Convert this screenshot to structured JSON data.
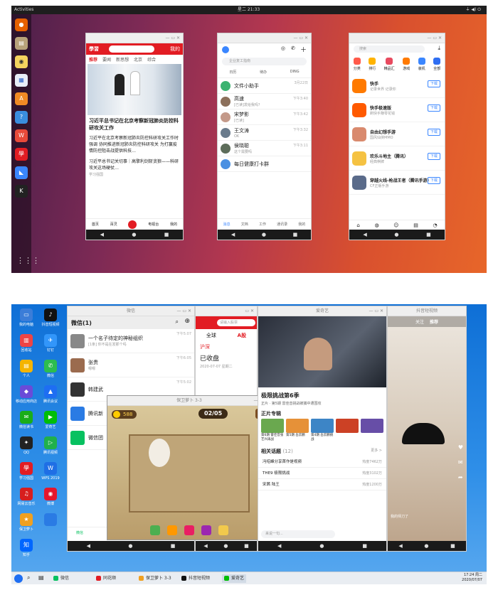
{
  "top": {
    "activities": "Activities",
    "clock": "星二 21:33",
    "news": {
      "tabs": [
        "推荐",
        "要闻",
        "新思想",
        "北京",
        "综合"
      ],
      "right_tab": "我的",
      "headline1": "习近平总书记在北京考察新冠肺炎防控科研攻关工作",
      "headline2": "习近平在北京考察新冠肺炎防控科研攻关工作时强调 协同推进新冠肺炎防控科研攻关 为打赢疫情防控阻击战提供科技…",
      "headline3": "习近平总书记关切事｜高擎利剑斩贪狼——科研攻关这场硬仗…",
      "source": "学习强国",
      "nav": [
        "首页",
        "百灵",
        "",
        "电视台",
        "我的"
      ]
    },
    "wechat": {
      "search_placeholder": "企业复工指南",
      "quick": [
        "日历",
        "待办",
        "DING"
      ],
      "chats": [
        {
          "name": "文件小助手",
          "msg": "",
          "time": "3月22日",
          "color": "#3cb371"
        },
        {
          "name": "高速",
          "msg": "[已读]发给我吗？",
          "time": "下午3:40",
          "color": "#8b6f5a"
        },
        {
          "name": "宋梦影",
          "msg": "[已读]",
          "time": "下午3:42",
          "color": "#c49a8a"
        },
        {
          "name": "王文涛",
          "msg": "OK",
          "time": "下午3:32",
          "color": "#6a7b8c"
        },
        {
          "name": "侯晓聪",
          "msg": "这个需要吗",
          "time": "下午3:11",
          "color": "#5d6d5a"
        },
        {
          "name": "每日健康打卡群",
          "msg": "",
          "time": "",
          "color": "#4a90e2"
        }
      ],
      "nav": [
        "消息",
        "文档",
        "工作",
        "通讯录",
        "我的"
      ]
    },
    "store": {
      "search_placeholder": "搜索",
      "cats": [
        "分类",
        "排行",
        "精品汇",
        "游戏",
        "装机",
        "全部"
      ],
      "apps": [
        {
          "name": "快手",
          "desc": "记录世界 记录你",
          "color": "#ff7a00"
        },
        {
          "name": "快手极速版",
          "desc": "刷快手赚零花钱",
          "color": "#ff5a00"
        },
        {
          "name": "自由幻想手游",
          "desc": "国风仙侠MMO",
          "color": "#d98a6e"
        },
        {
          "name": "欢乐斗地主（腾讯）",
          "desc": "经典棋牌",
          "color": "#f5c242"
        },
        {
          "name": "穿越火线-枪战王者（腾讯手游）",
          "desc": "CF正版手游",
          "color": "#5a6b8a"
        }
      ],
      "download": "下载"
    }
  },
  "bottom": {
    "desktop_icons": [
      {
        "label": "我的电脑",
        "color": "#3b7dd8",
        "glyph": "▭"
      },
      {
        "label": "抖音短视频",
        "color": "#111",
        "glyph": "♪"
      },
      {
        "label": "回收站",
        "color": "#e44",
        "glyph": "▥"
      },
      {
        "label": "钉钉",
        "color": "#3296fa",
        "glyph": "✈"
      },
      {
        "label": "个人",
        "color": "#f4b400",
        "glyph": "▤"
      },
      {
        "label": "微信",
        "color": "#2dbd4e",
        "glyph": "✆"
      },
      {
        "label": "移动应用商店",
        "color": "#6a4bd8",
        "glyph": "◆"
      },
      {
        "label": "腾讯会议",
        "color": "#1e6ef2",
        "glyph": "▲"
      },
      {
        "label": "微信读书",
        "color": "#1aad19",
        "glyph": "✉"
      },
      {
        "label": "爱奇艺",
        "color": "#00be06",
        "glyph": "▶"
      },
      {
        "label": "QQ",
        "color": "#222",
        "glyph": "✦"
      },
      {
        "label": "腾讯视频",
        "color": "#20b04b",
        "glyph": "▷"
      },
      {
        "label": "学习强国",
        "color": "#e21c23",
        "glyph": "學"
      },
      {
        "label": "WPS 2019",
        "color": "#1f6fe5",
        "glyph": "W"
      },
      {
        "label": "网易云音乐",
        "color": "#d71e1e",
        "glyph": "♫"
      },
      {
        "label": "微博",
        "color": "#e6162d",
        "glyph": "◉"
      },
      {
        "label": "保卫萝卜",
        "color": "#f0a020",
        "glyph": "★"
      },
      {
        "label": "",
        "color": "#2a7be4",
        "glyph": ""
      },
      {
        "label": "知乎",
        "color": "#0066ff",
        "glyph": "知"
      }
    ],
    "wechat": {
      "title": "微信(1)",
      "window_title": "微信",
      "chats": [
        {
          "name": "一个名子待定的神秘组织",
          "msg": "[1条] 你不是在发那个吗",
          "time": "下午5:07"
        },
        {
          "name": "张贵",
          "msg": "嗯嗯",
          "time": "下午6:05"
        },
        {
          "name": "韩建武",
          "msg": "",
          "time": "下午5:02"
        },
        {
          "name": "腾讯新",
          "msg": "",
          "time": ""
        },
        {
          "name": "微信团",
          "msg": "",
          "time": ""
        }
      ],
      "tab": "微信"
    },
    "stock": {
      "search_placeholder": "请输入股票",
      "tabs": [
        "全球",
        "A股"
      ],
      "market": "沪深",
      "status": "已收盘",
      "date": "2020-07-07 星期二"
    },
    "game": {
      "window_title": "保卫萝卜 3-3",
      "coins": "588",
      "wave": "02/05"
    },
    "iqiyi": {
      "window_title": "爱奇艺",
      "title": "极限挑战第6季",
      "meta": "正片 · 第5期 雷佳音挑战被捕中遭围攻",
      "section": "正片专辑",
      "episodes": [
        "第6期 雷佳音张艺兴再战",
        "第5期 岳云鹏",
        "第4期 岳云鹏挑战",
        "",
        ""
      ],
      "related": "相关话题",
      "related_count": "(12)",
      "more": "更多 >",
      "topics": [
        {
          "text": "冯绍峰分享首作是视频",
          "heat": "热度7462万"
        },
        {
          "text": "THE9 极限挑战",
          "heat": "热度3102万"
        },
        {
          "text": "宋茜 陆王",
          "heat": "热度1200万"
        }
      ],
      "comment_placeholder": "来说一句..."
    },
    "douyin": {
      "window_title": "抖音短视频",
      "tabs": [
        "关注",
        "推荐"
      ],
      "caption": "我的师刀了"
    },
    "taskbar": {
      "items": [
        "微信",
        "同花顺",
        "保卫萝卜 3-3",
        "抖音短视频",
        "爱奇艺"
      ],
      "time": "17:24 周二",
      "date": "2020/07/07"
    }
  }
}
